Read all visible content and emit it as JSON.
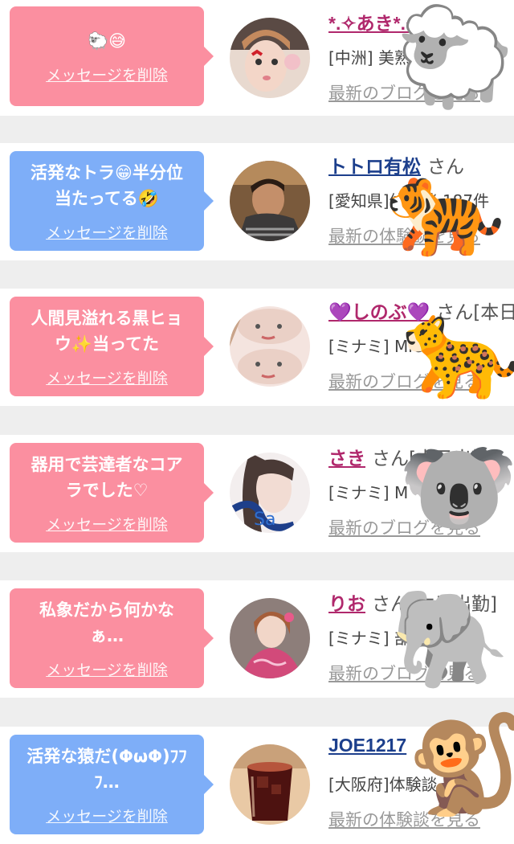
{
  "cards": [
    {
      "message": "🐑😅",
      "delete_label": "メッセージを削除",
      "name": "*.✧あき*.✧",
      "san": "さん",
      "info": "[中洲] 美熟",
      "link": "最新のブログを見る",
      "animal": "🐑",
      "bubble_color": "pink"
    },
    {
      "message": "活発なトラ😁半分位\n当たってる🤣",
      "delete_label": "メッセージを削除",
      "name": "トトロ有松",
      "san": "さん",
      "info": "[愛知県]体験談 187件",
      "link": "最新の体験談を見る",
      "animal": "🐅",
      "bubble_color": "blue"
    },
    {
      "message": "人間見溢れる黒ヒョ\nウ✨当ってた",
      "delete_label": "メッセージを削除",
      "name": "💜しのぶ💜",
      "san": "さん[本日",
      "info": "[ミナミ] Mrs",
      "link": "最新のブログを見る",
      "animal": "🐆",
      "bubble_color": "pink"
    },
    {
      "message": "器用で芸達者なコア\nラでした♡",
      "delete_label": "メッセージを削除",
      "name": "さき",
      "san": "さん[本日出勤]",
      "info": "[ミナミ] M",
      "link": "最新のブログを見る",
      "animal": "🐨",
      "bubble_color": "pink"
    },
    {
      "message": "私象だから何かな\nぁ…",
      "delete_label": "メッセージを削除",
      "name": "りお",
      "san": "さん[本日出勤]",
      "info": "[ミナミ]                部",
      "link": "最新のブログを見る",
      "animal": "🐘",
      "bubble_color": "pink"
    },
    {
      "message": "活発な猿だ(ΦωΦ)ﾌﾌ\nﾌ…",
      "delete_label": "メッセージを削除",
      "name": "JOE1217",
      "san": "",
      "info": "[大阪府]体験談",
      "link": "最新の体験談を見る",
      "animal": "🐒",
      "bubble_color": "blue"
    }
  ]
}
